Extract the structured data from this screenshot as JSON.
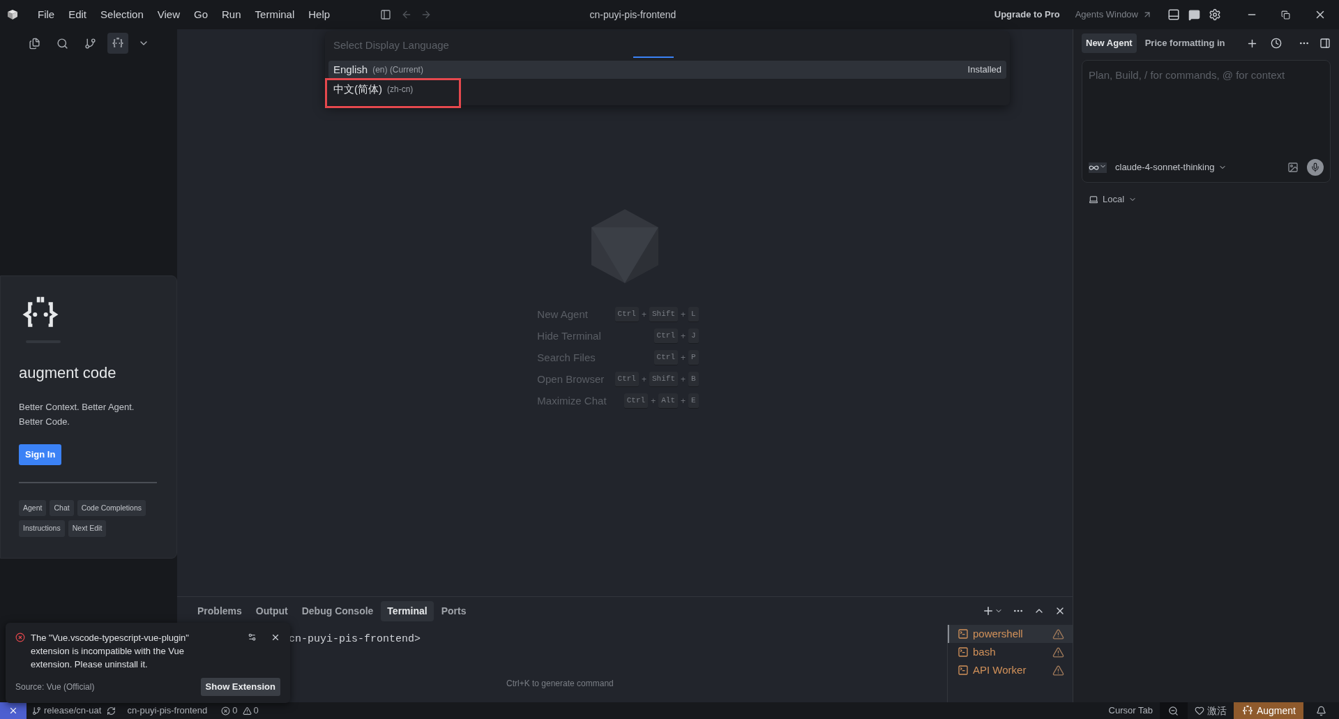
{
  "menu": [
    "File",
    "Edit",
    "Selection",
    "View",
    "Go",
    "Run",
    "Terminal",
    "Help"
  ],
  "window": {
    "title": "cn-puyi-pis-frontend"
  },
  "titlebar_right": {
    "upgrade": "Upgrade to Pro",
    "agents_window": "Agents Window"
  },
  "activity": [
    {
      "kind": "files",
      "selected": false
    },
    {
      "kind": "search",
      "selected": false
    },
    {
      "kind": "branch",
      "selected": false
    },
    {
      "kind": "augment",
      "selected": true
    }
  ],
  "language_picker": {
    "placeholder": "Select Display Language",
    "loading": true,
    "items": [
      {
        "name": "English",
        "detail": "(en) (Current)",
        "badge": "Installed",
        "selected": true,
        "annotated": false
      },
      {
        "name": "中文(简体)",
        "detail": "(zh-cn)",
        "selected": false,
        "annotated": true
      }
    ]
  },
  "augment_card": {
    "title": "augment code",
    "tagline": "Better Context. Better Agent. Better Code.",
    "sign_in": "Sign In",
    "tags": [
      "Agent",
      "Chat",
      "Code Completions",
      "Instructions",
      "Next Edit"
    ]
  },
  "shortcuts": [
    {
      "label": "New Agent",
      "keys": [
        "Ctrl",
        "Shift",
        "L"
      ]
    },
    {
      "label": "Hide Terminal",
      "keys": [
        "Ctrl",
        "J"
      ]
    },
    {
      "label": "Search Files",
      "keys": [
        "Ctrl",
        "P"
      ]
    },
    {
      "label": "Open Browser",
      "keys": [
        "Ctrl",
        "Shift",
        "B"
      ]
    },
    {
      "label": "Maximize Chat",
      "keys": [
        "Ctrl",
        "Alt",
        "E"
      ]
    }
  ],
  "key_joiner": "+",
  "panel": {
    "tabs": [
      {
        "label": "Problems",
        "selected": false
      },
      {
        "label": "Output",
        "selected": false
      },
      {
        "label": "Debug Console",
        "selected": false
      },
      {
        "label": "Terminal",
        "selected": true
      },
      {
        "label": "Ports",
        "selected": false
      }
    ],
    "prompt": "cn-puyi-pis-frontend>",
    "hint": "Ctrl+K to generate command",
    "terminals": [
      {
        "name": "powershell",
        "selected": true
      },
      {
        "name": "bash",
        "selected": false
      },
      {
        "name": "API Worker",
        "selected": false
      }
    ]
  },
  "notification": {
    "message": "The \"Vue.vscode-typescript-vue-plugin\" extension is incompatible with the Vue extension. Please uninstall it.",
    "source": "Source: Vue (Official)",
    "action": "Show Extension"
  },
  "agent_panel": {
    "tabs": [
      {
        "label": "New Agent",
        "selected": true
      },
      {
        "label": "Price formatting in",
        "selected": false
      }
    ],
    "placeholder": "Plan, Build, / for commands, @ for context",
    "mode_toggle": {
      "on": true
    },
    "model": "claude-4-sonnet-thinking",
    "location": "Local"
  },
  "status_bar": {
    "branch": "release/cn-uat",
    "project": "cn-puyi-pis-frontend",
    "errors": "0",
    "warnings": "0",
    "cursor_tab": "Cursor Tab",
    "activate": "激活",
    "augment": "Augment"
  }
}
